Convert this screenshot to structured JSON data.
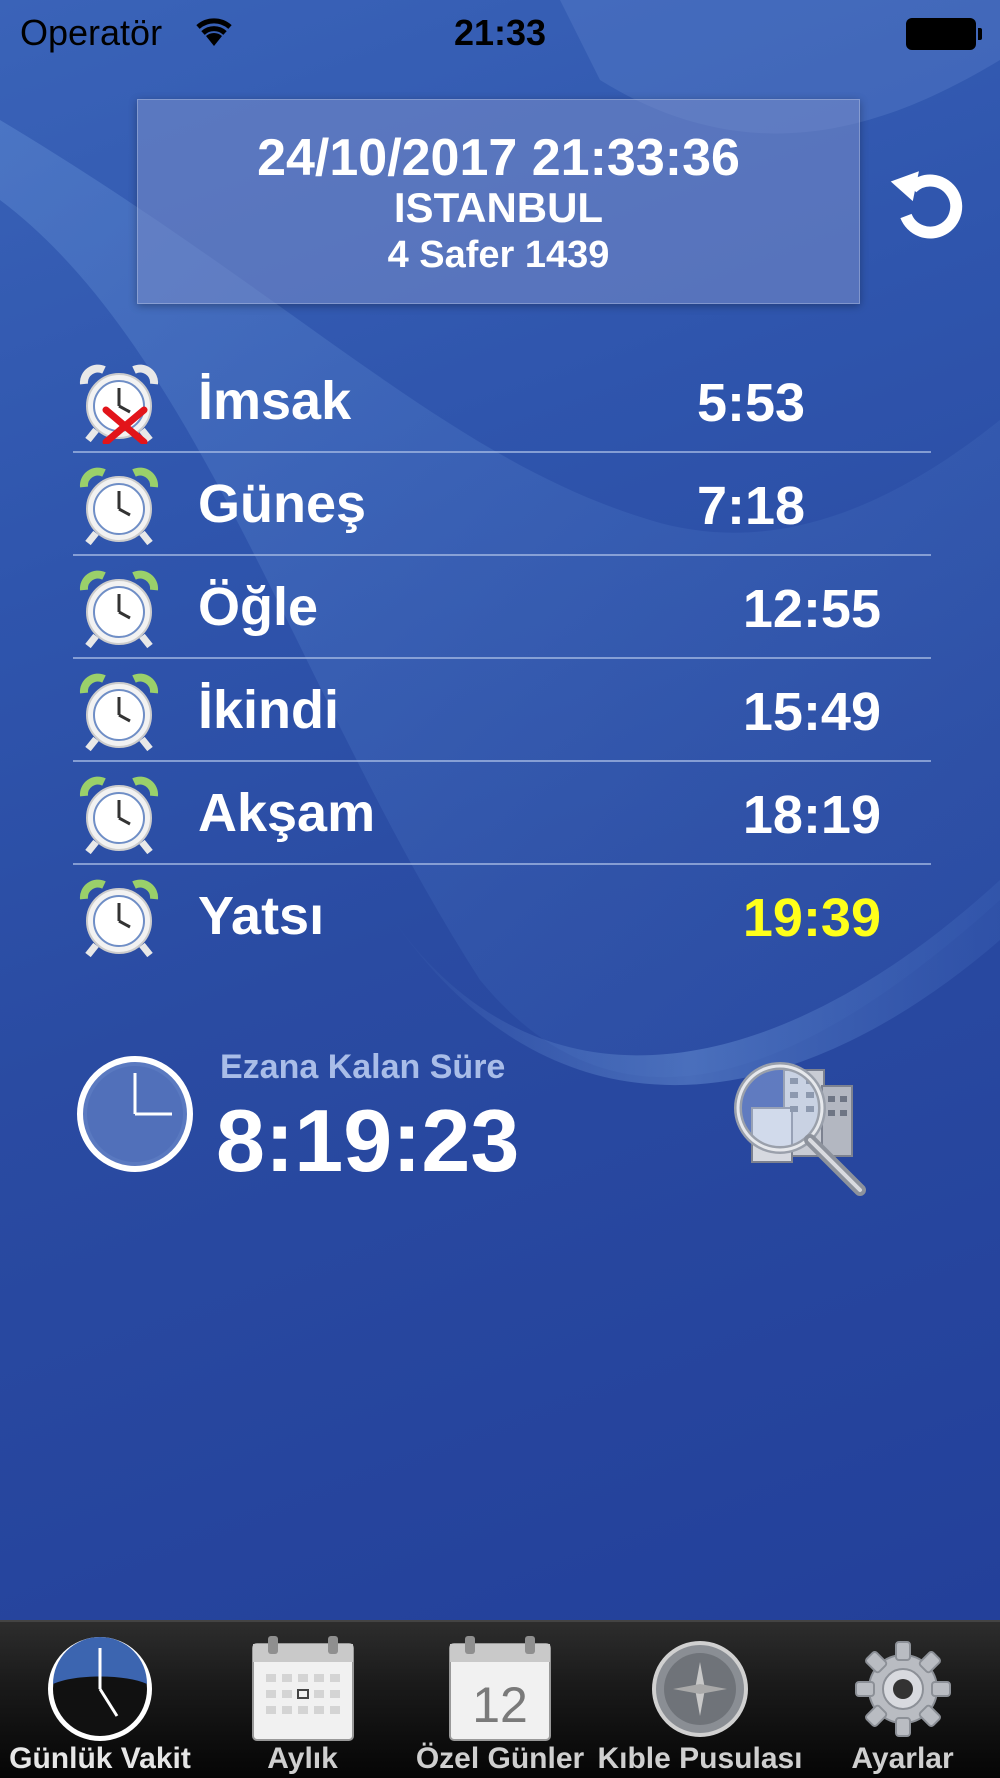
{
  "status_bar": {
    "carrier": "Operatör",
    "time": "21:33"
  },
  "header": {
    "datetime": "24/10/2017 21:33:36",
    "city": "ISTANBUL",
    "hijri_date": "4 Safer 1439"
  },
  "prayers": [
    {
      "name": "İmsak",
      "time": "5:53",
      "alarm_icon": "alarm-off-icon",
      "highlight": false
    },
    {
      "name": "Güneş",
      "time": "7:18",
      "alarm_icon": "alarm-clock-icon",
      "highlight": false
    },
    {
      "name": "Öğle",
      "time": "12:55",
      "alarm_icon": "alarm-clock-icon",
      "highlight": false
    },
    {
      "name": "İkindi",
      "time": "15:49",
      "alarm_icon": "alarm-clock-icon",
      "highlight": false
    },
    {
      "name": "Akşam",
      "time": "18:19",
      "alarm_icon": "alarm-clock-icon",
      "highlight": false
    },
    {
      "name": "Yatsı",
      "time": "19:39",
      "alarm_icon": "alarm-clock-icon",
      "highlight": true
    }
  ],
  "countdown": {
    "label": "Ezana Kalan Süre",
    "value": "8:19:23"
  },
  "tabs": [
    {
      "label": "Günlük Vakit",
      "icon": "daily-clock-icon",
      "active": true
    },
    {
      "label": "Aylık",
      "icon": "monthly-calendar-icon",
      "active": false
    },
    {
      "label": "Özel Günler",
      "icon": "special-days-calendar-icon",
      "active": false
    },
    {
      "label": "Kıble Pusulası",
      "icon": "compass-icon",
      "active": false
    },
    {
      "label": "Ayarlar",
      "icon": "gear-icon",
      "active": false
    }
  ],
  "colors": {
    "highlight_time": "#ffff1a",
    "countdown_label": "#a9bde8"
  }
}
